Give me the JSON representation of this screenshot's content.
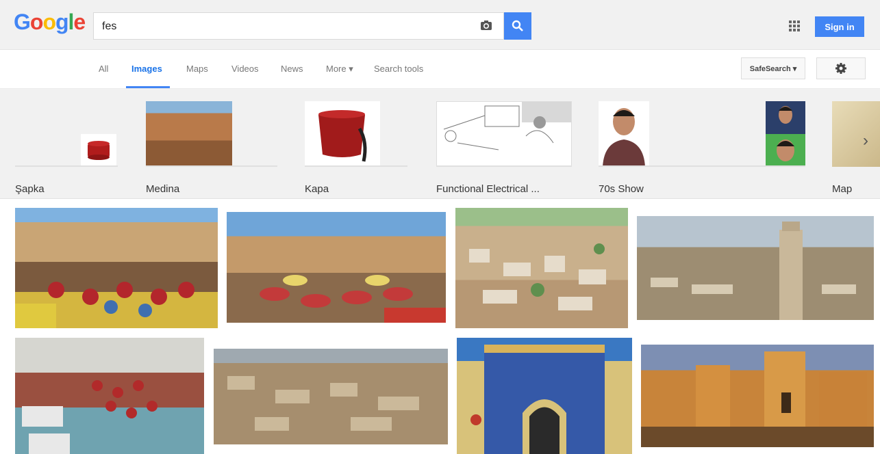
{
  "header": {
    "logo_letters": [
      "G",
      "o",
      "o",
      "g",
      "l",
      "e"
    ],
    "query": "fes",
    "sign_in_label": "Sign in"
  },
  "tabs": [
    {
      "label": "All"
    },
    {
      "label": "Images"
    },
    {
      "label": "Maps"
    },
    {
      "label": "Videos"
    },
    {
      "label": "News"
    },
    {
      "label": "More ▾"
    },
    {
      "label": "Search tools"
    }
  ],
  "safe_search_label": "SafeSearch ▾",
  "related": [
    {
      "label": "Şapka"
    },
    {
      "label": "Medina"
    },
    {
      "label": "Kapa"
    },
    {
      "label": "Functional Electrical ..."
    },
    {
      "label": "70s Show"
    },
    {
      "label": "Map"
    }
  ],
  "colors": {
    "accent": "#4285f4",
    "topbar": "#f1f1f1"
  }
}
